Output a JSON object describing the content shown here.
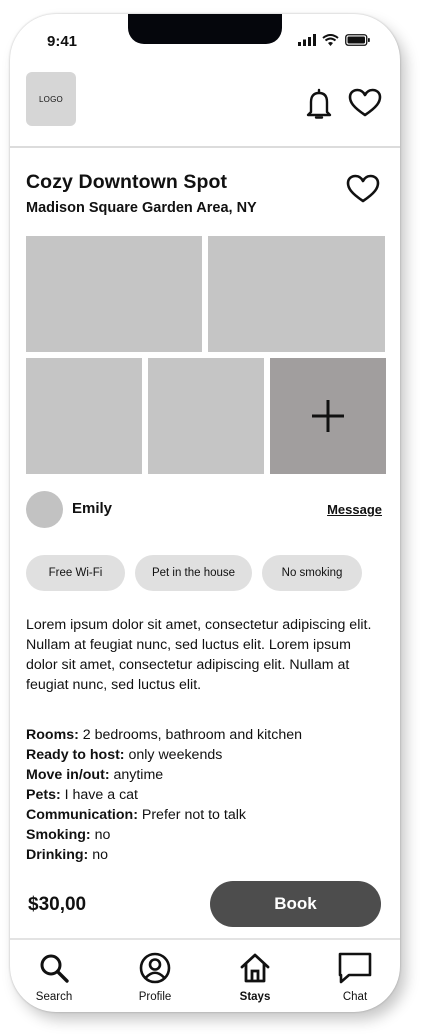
{
  "status_bar": {
    "time": "9:41"
  },
  "header": {
    "logo_text": "LOGO"
  },
  "listing": {
    "title": "Cozy Downtown Spot",
    "location": "Madison Square Garden Area, NY"
  },
  "host": {
    "name": "Emily",
    "message_label": "Message"
  },
  "amenities": [
    "Free Wi-Fi",
    "Pet in the house",
    "No smoking"
  ],
  "description": "Lorem ipsum dolor sit amet, consectetur adipiscing elit. Nullam at feugiat nunc, sed luctus elit. Lorem ipsum dolor sit amet, consectetur adipiscing elit. Nullam at feugiat nunc, sed luctus elit.",
  "details": [
    {
      "label": "Rooms:",
      "value": " 2 bedrooms, bathroom and kitchen"
    },
    {
      "label": "Ready to host:",
      "value": " only weekends"
    },
    {
      "label": "Move in/out:",
      "value": " anytime"
    },
    {
      "label": "Pets:",
      "value": " I have a cat"
    },
    {
      "label": "Communication:",
      "value": " Prefer not to talk"
    },
    {
      "label": "Smoking:",
      "value": " no"
    },
    {
      "label": "Drinking:",
      "value": " no"
    }
  ],
  "booking": {
    "price": "$30,00",
    "book_label": "Book"
  },
  "tabbar": {
    "items": [
      {
        "label": "Search",
        "icon": "search-icon"
      },
      {
        "label": "Profile",
        "icon": "profile-icon"
      },
      {
        "label": "Stays",
        "icon": "home-icon",
        "active": true
      },
      {
        "label": "Chat",
        "icon": "chat-icon"
      }
    ]
  },
  "colors": {
    "book_button": "#4d4d4d",
    "placeholder": "#c5c5c5",
    "chip": "#e0e0e0"
  }
}
